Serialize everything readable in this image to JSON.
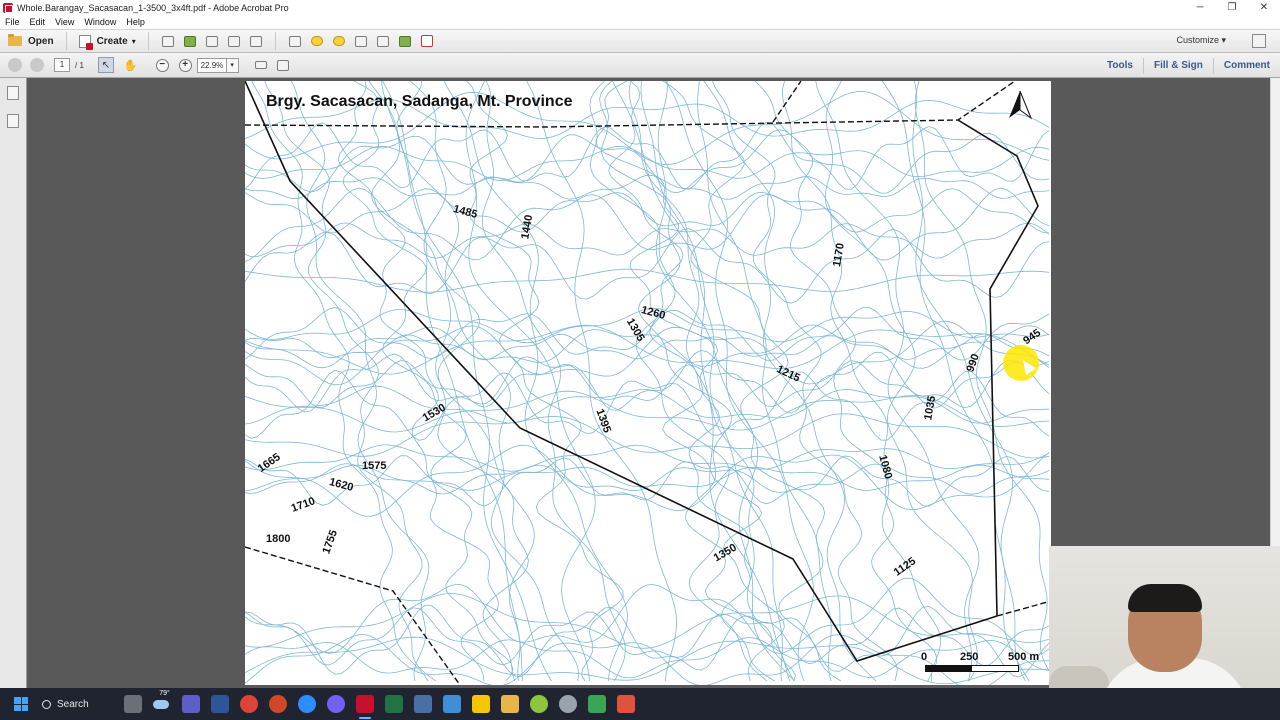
{
  "window": {
    "title": "Whole.Barangay_Sacasacan_1-3500_3x4ft.pdf - Adobe Acrobat Pro",
    "controls": [
      "─",
      "❐",
      "✕"
    ]
  },
  "menu": [
    "File",
    "Edit",
    "View",
    "Window",
    "Help"
  ],
  "toolbar": {
    "open_label": "Open",
    "create_label": "Create",
    "create_caret": "▾",
    "customize_label": "Customize ▾"
  },
  "nav": {
    "page_current": "1",
    "page_total": "/ 1",
    "zoom": "22.9%",
    "zoom_caret": "▾",
    "zoom_out": "−",
    "zoom_in": "+",
    "select_glyph": "↖",
    "hand_glyph": "✋"
  },
  "panels": {
    "tools": "Tools",
    "fill_sign": "Fill & Sign",
    "comment": "Comment"
  },
  "map": {
    "title": "Brgy. Sacasacan, Sadanga, Mt. Province",
    "elevations": [
      "1485",
      "1440",
      "1170",
      "1260",
      "1305",
      "1215",
      "945",
      "990",
      "1035",
      "1530",
      "1395",
      "1665",
      "1575",
      "1620",
      "1080",
      "1710",
      "1800",
      "1755",
      "1350",
      "1125"
    ],
    "scale_labels": [
      "0",
      "250",
      "500 m"
    ]
  },
  "taskbar": {
    "search_label": "Search",
    "weather_temp": "79°"
  },
  "colors": {
    "contour": "#7fb8d8",
    "boundary": "#111111",
    "accent_tabs": "#3a5a8c",
    "cursor_highlight": "#ffe600"
  }
}
